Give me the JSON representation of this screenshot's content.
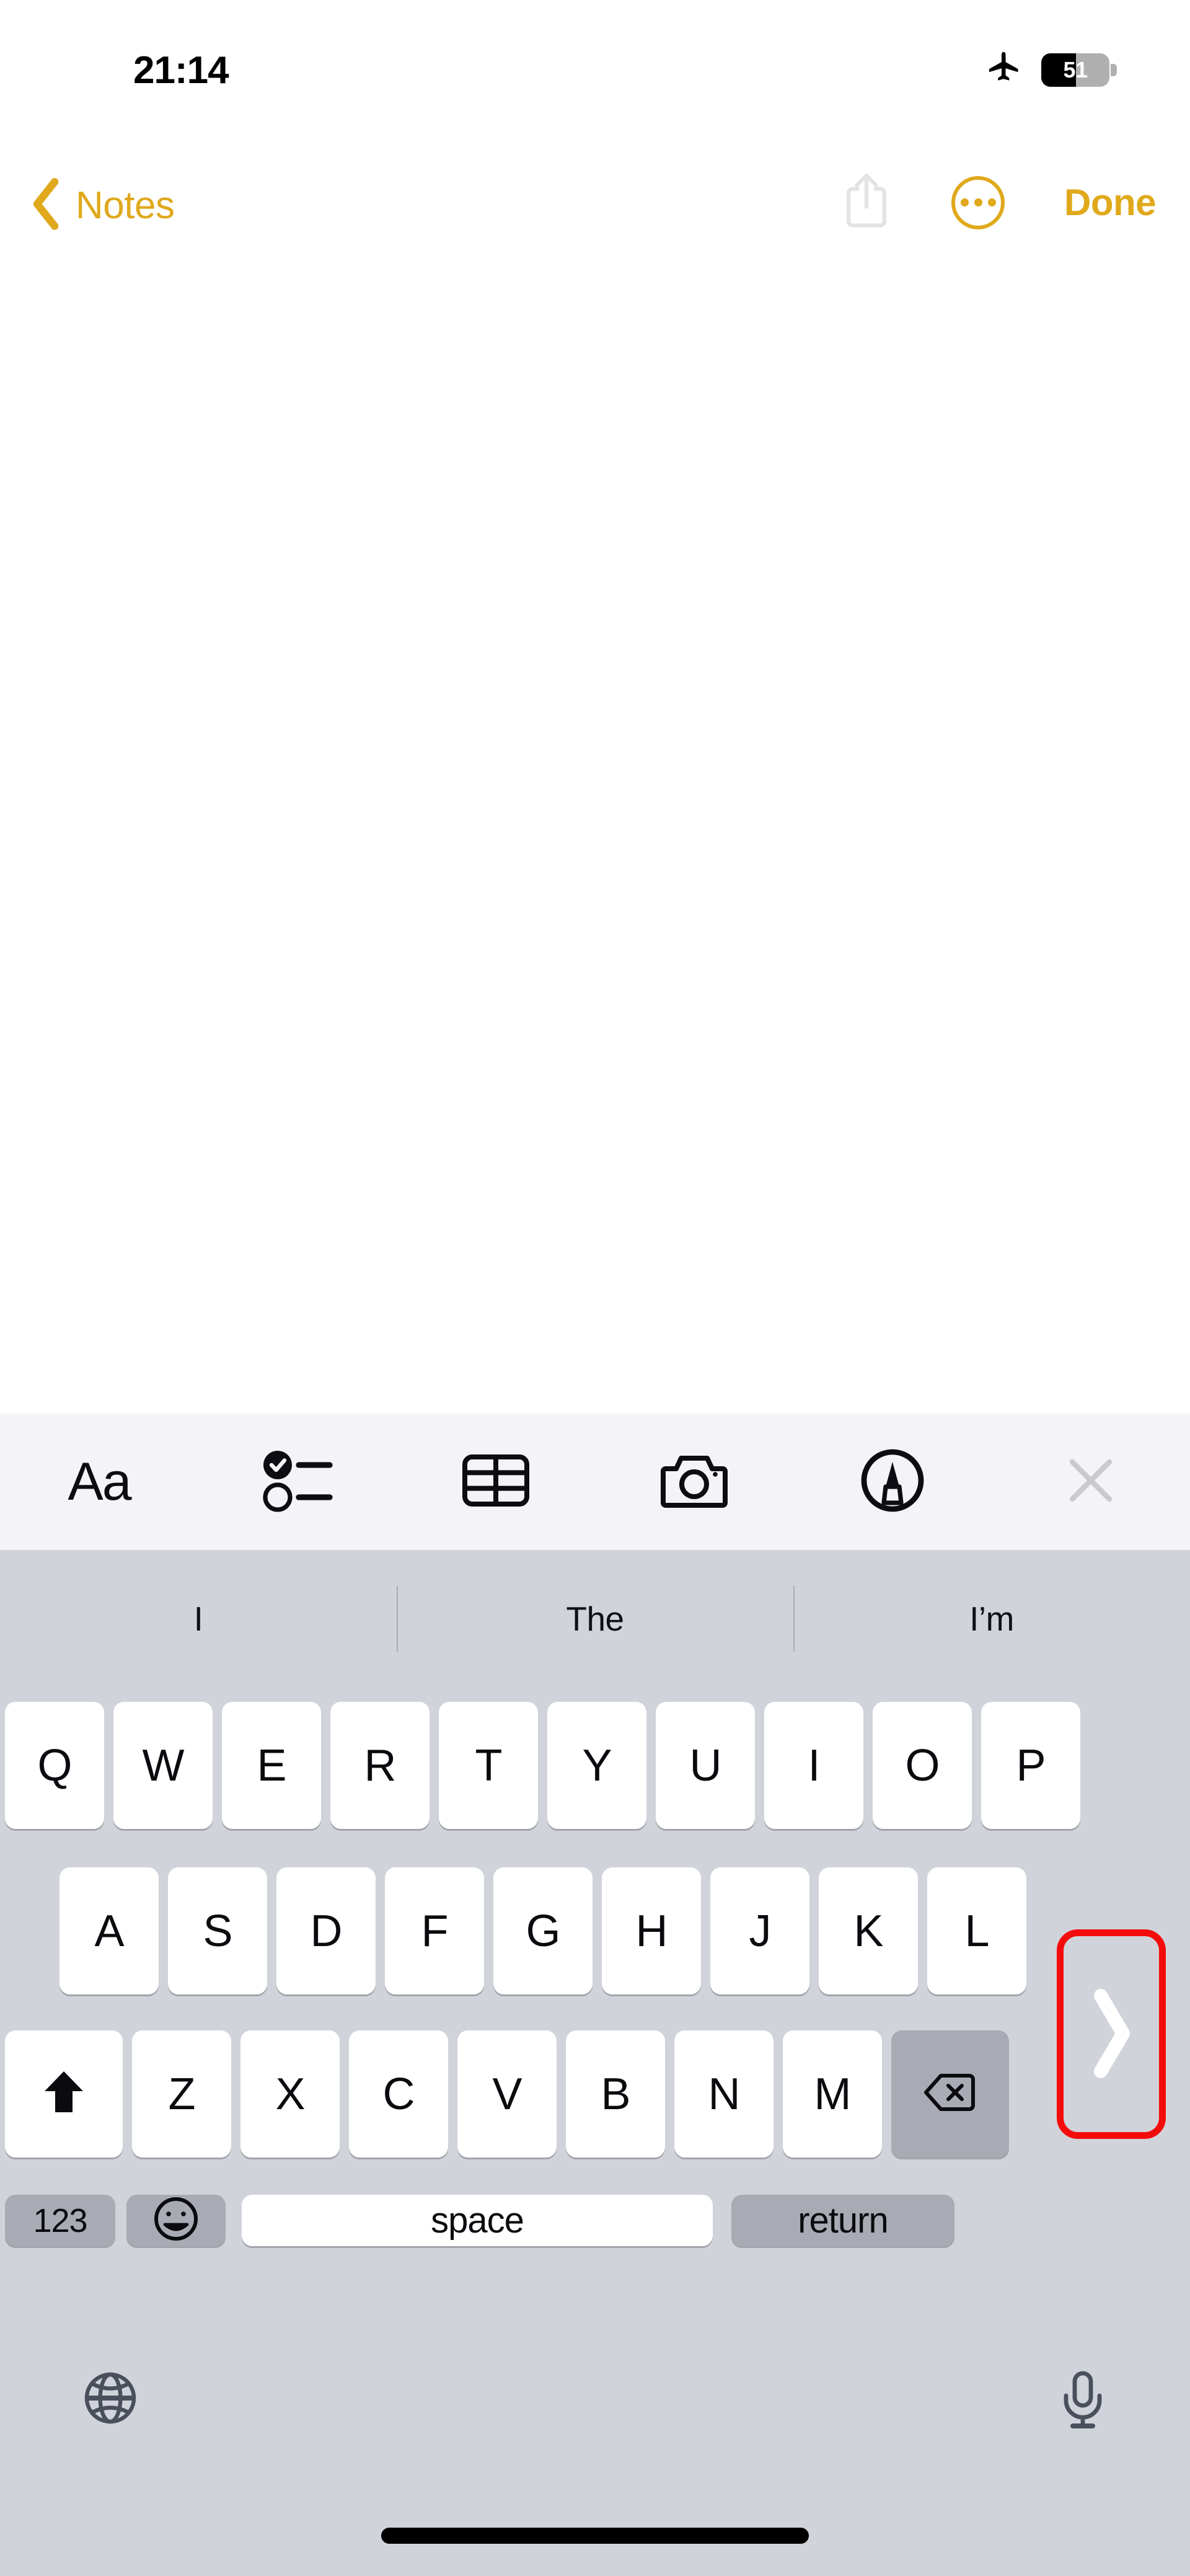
{
  "status_bar": {
    "time": "21:14",
    "airplane_icon": "airplane-mode-icon",
    "battery": {
      "percent_label": "51",
      "level": 51,
      "fill_color": "#000000",
      "track_color": "#b0b0b0"
    }
  },
  "nav_bar": {
    "back_icon": "chevron-left-icon",
    "back_label": "Notes",
    "share_icon": "share-icon",
    "more_icon": "more-circle-icon",
    "done_label": "Done",
    "accent_color": "#e0a91b",
    "share_disabled_color": "#e3e3e6"
  },
  "note": {
    "body_text": "",
    "background": "#ffffff"
  },
  "format_toolbar": {
    "background": "#f4f4f8",
    "items": [
      {
        "name": "format-text-button",
        "label": "Aa",
        "icon": "aa-format-icon"
      },
      {
        "name": "checklist-button",
        "label": "",
        "icon": "checklist-icon"
      },
      {
        "name": "table-button",
        "label": "",
        "icon": "table-icon"
      },
      {
        "name": "camera-button",
        "label": "",
        "icon": "camera-icon"
      },
      {
        "name": "markup-button",
        "label": "",
        "icon": "markup-pen-icon"
      },
      {
        "name": "close-keyboard-button",
        "label": "",
        "icon": "close-x-icon"
      }
    ]
  },
  "keyboard": {
    "background": "#d1d3db",
    "key_color": "#ffffff",
    "special_key_color": "#a9abb4",
    "predictions": [
      "I",
      "The",
      "I’m"
    ],
    "row1": [
      "Q",
      "W",
      "E",
      "R",
      "T",
      "Y",
      "U",
      "I",
      "O",
      "P"
    ],
    "row2": [
      "A",
      "S",
      "D",
      "F",
      "G",
      "H",
      "J",
      "K",
      "L"
    ],
    "row3_letters": [
      "Z",
      "X",
      "C",
      "V",
      "B",
      "N",
      "M"
    ],
    "shift_icon": "shift-up-arrow-icon",
    "shift_state": "active",
    "backspace_icon": "backspace-delete-icon",
    "numbers_label": "123",
    "emoji_icon": "emoji-smiley-icon",
    "space_label": "space",
    "return_label": "return",
    "globe_icon": "globe-language-icon",
    "mic_icon": "microphone-dictation-icon"
  },
  "annotation": {
    "highlight_color": "#f40c0c",
    "target_icon": "chevron-right-icon",
    "target_name": "expand-toolbar-chevron"
  },
  "home_indicator": {
    "color": "#000000"
  }
}
